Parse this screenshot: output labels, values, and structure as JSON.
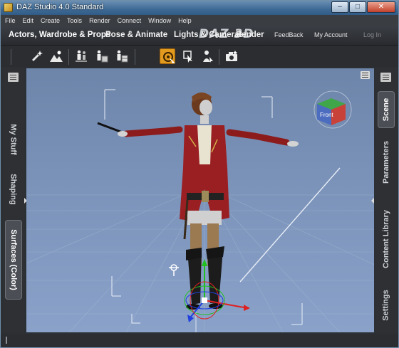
{
  "window": {
    "title": "DAZ Studio 4.0 Standard",
    "minimize": "–",
    "maximize": "□",
    "close": "✕"
  },
  "menus": [
    "File",
    "Edit",
    "Create",
    "Tools",
    "Render",
    "Connect",
    "Window",
    "Help"
  ],
  "rooms": [
    {
      "label": "Actors, Wardrobe & Props",
      "active": true
    },
    {
      "label": "Pose & Animate",
      "active": false
    },
    {
      "label": "Lights & Cameras",
      "active": false
    },
    {
      "label": "Render",
      "active": false
    }
  ],
  "logo": "DAZ 3D",
  "header_links": {
    "feedback": "FeedBack",
    "account": "My Account",
    "login": "Log In"
  },
  "toolbar_icons": [
    "light-sparkle-icon",
    "mountain-scene-icon",
    "figure-group-icon",
    "figure-room-icon",
    "figure-crate-icon",
    "universal-tool-icon",
    "node-select-icon",
    "figure-select-icon",
    "camera-render-icon"
  ],
  "active_tool": "universal-tool-icon",
  "left_tabs": [
    {
      "label": "My Stuff",
      "active": false
    },
    {
      "label": "Shaping",
      "active": false
    },
    {
      "label": "Surfaces (Color)",
      "active": true
    }
  ],
  "right_tabs": [
    {
      "label": "Scene",
      "active": true
    },
    {
      "label": "Parameters",
      "active": false
    },
    {
      "label": "Content Library",
      "active": false
    },
    {
      "label": "Settings",
      "active": false
    }
  ],
  "viewport": {
    "cube_label": "Front"
  },
  "colors": {
    "accent": "#e29a1f",
    "titlebar": "#3e6a95",
    "viewport_bg": "#7a92b8"
  }
}
